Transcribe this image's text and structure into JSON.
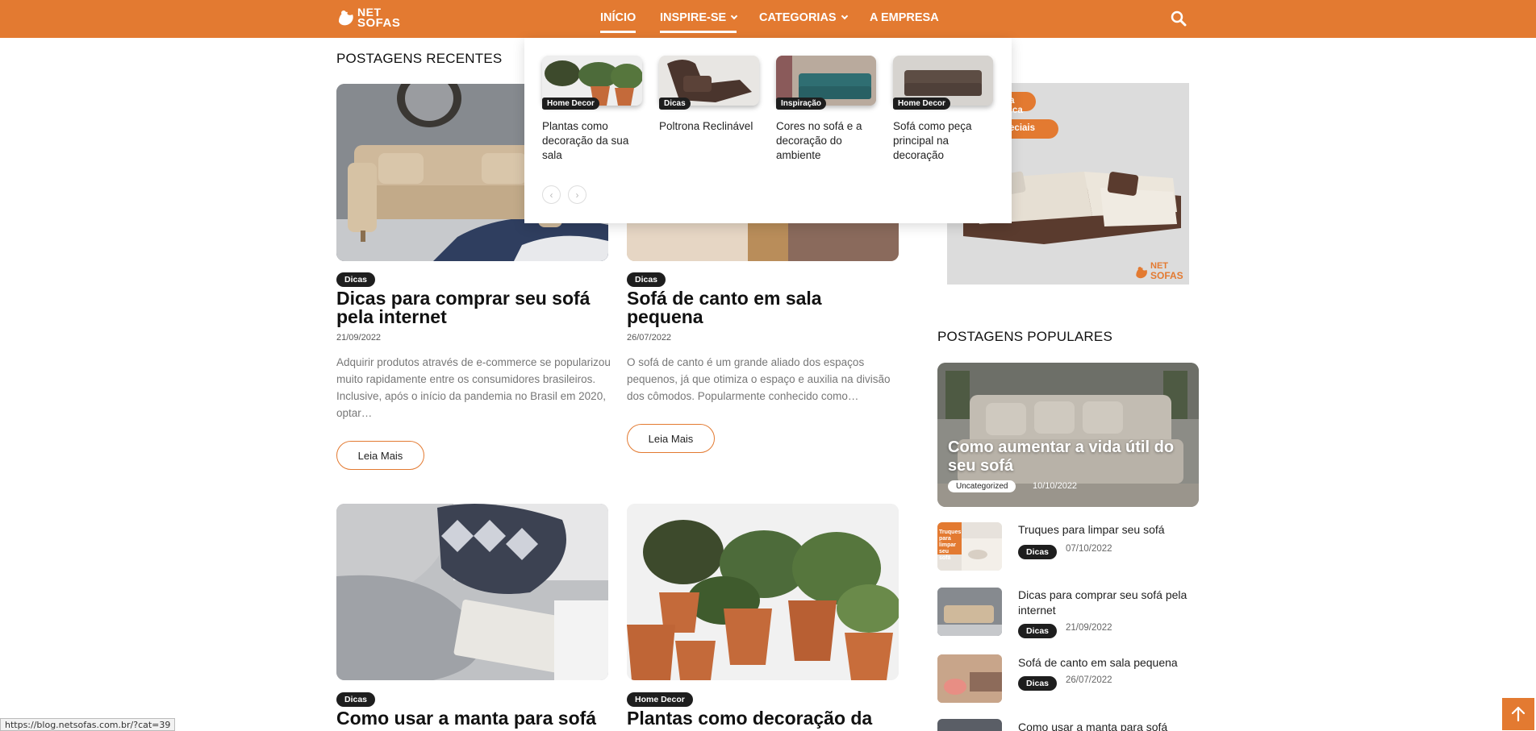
{
  "header": {
    "logo_line1": "NET",
    "logo_line2": "SOFAS",
    "nav": [
      {
        "label": "INÍCIO"
      },
      {
        "label": "INSPIRE-SE"
      },
      {
        "label": "CATEGORIAS"
      },
      {
        "label": "A EMPRESA"
      }
    ]
  },
  "dropdown": {
    "items": [
      {
        "badge": "Home Decor",
        "title": "Plantas como decoração da sua sala"
      },
      {
        "badge": "Dicas",
        "title": " Poltrona Reclinável"
      },
      {
        "badge": "Inspiração",
        "title": "Cores no sofá e a decoração do ambiente"
      },
      {
        "badge": "Home Decor",
        "title": "Sofá como peça principal na decoração"
      }
    ],
    "prev": "‹",
    "next": "›"
  },
  "recent": {
    "title": "POSTAGENS RECENTES",
    "posts": [
      {
        "badge": "Dicas",
        "title": "Dicas para comprar seu sofá pela internet",
        "date": "21/09/2022",
        "excerpt": "Adquirir produtos através de e-commerce se popularizou muito rapidamente entre os consumidores brasileiros. Inclusive, após o início da pandemia no Brasil em 2020, optar…",
        "button": "Leia Mais"
      },
      {
        "badge": "Dicas",
        "title": "Sofá de canto em sala pequena",
        "date": "26/07/2022",
        "excerpt": "O sofá de canto é um grande aliado dos espaços pequenos, já que otimiza o espaço e auxilia na divisão dos cômodos.  Popularmente conhecido como…",
        "button": "Leia Mais"
      },
      {
        "badge": "Dicas",
        "title": "Como usar a manta para sofá"
      },
      {
        "badge": "Home Decor",
        "title": "Plantas como decoração da"
      }
    ]
  },
  "ad": {
    "tag1": "to da fábrica",
    "tag2": "peciais",
    "logo_line1": "NET",
    "logo_line2": "SOFAS"
  },
  "popular": {
    "title": "POSTAGENS POPULARES",
    "featured": {
      "title": "Como aumentar a vida útil do seu sofá",
      "badge": "Uncategorized",
      "date": "10/10/2022"
    },
    "thumb_text": "Truques para limpar seu sofá",
    "items": [
      {
        "title": "Truques para limpar seu sofá",
        "badge": "Dicas",
        "date": "07/10/2022"
      },
      {
        "title": "Dicas para comprar seu sofá pela internet",
        "badge": "Dicas",
        "date": "21/09/2022"
      },
      {
        "title": "Sofá de canto em sala pequena",
        "badge": "Dicas",
        "date": "26/07/2022"
      },
      {
        "title": "Como usar a manta para sofá"
      }
    ]
  },
  "status_bar": "https://blog.netsofas.com.br/?cat=39",
  "colors": {
    "accent": "#e37a31",
    "badge": "#1e1e1e"
  }
}
